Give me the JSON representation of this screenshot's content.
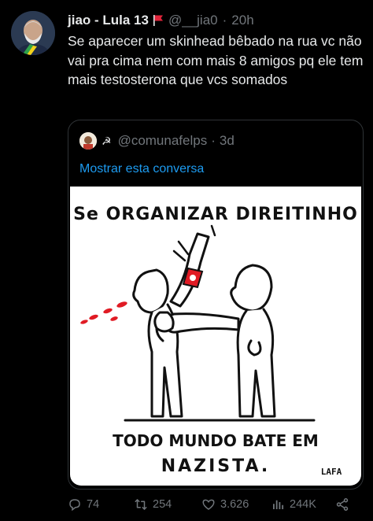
{
  "author": {
    "name": "jiao - Lula 13",
    "handle": "@__jia0",
    "time": "20h",
    "flag_icon": "red-flag-icon"
  },
  "tweet_text": "Se aparecer um skinhead bêbado na rua vc não vai pra cima nem com mais 8 amigos pq ele tem mais testosterona que vcs somados",
  "quote": {
    "sickle_icon": "☭",
    "handle": "@comunafelps",
    "time": "3d",
    "show_thread": "Mostrar esta conversa",
    "comic": {
      "top_caption": "Se ORGANIZAR DIREITINHO",
      "bottom_caption_line1": "TODO MUNDO BATE EM",
      "bottom_caption_line2": "NAZISTA.",
      "signature": "LAFA"
    }
  },
  "actions": {
    "replies": "74",
    "retweets": "254",
    "likes": "3.626",
    "views": "244K"
  },
  "colors": {
    "background": "#000000",
    "text": "#e7e9ea",
    "muted": "#71767b",
    "link": "#1d9bf0",
    "border": "#2f3336"
  }
}
